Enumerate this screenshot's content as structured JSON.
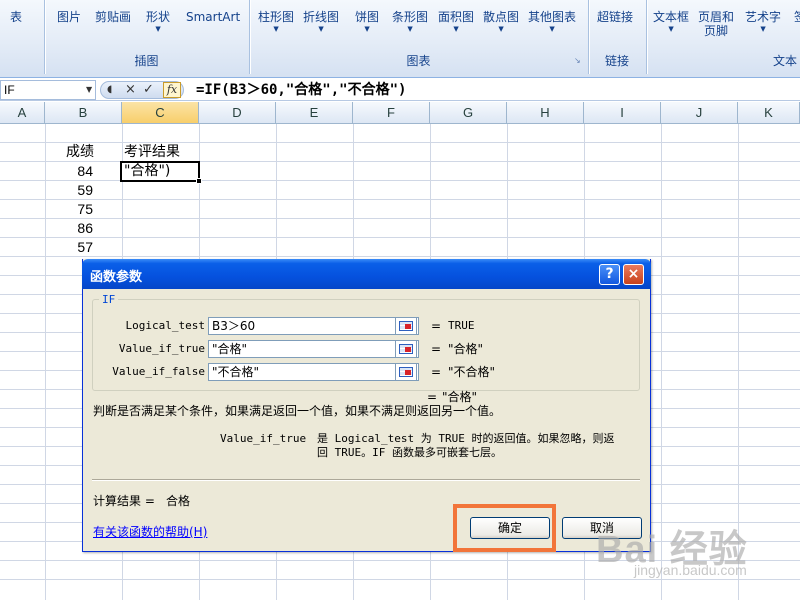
{
  "ribbon": {
    "groups": {
      "illustrations": "插图",
      "charts": "图表",
      "links": "链接",
      "text": "文本"
    },
    "buttons": {
      "table": "表",
      "picture": "图片",
      "clipart": "剪贴画",
      "shapes": "形状",
      "smartart": "SmartArt",
      "column_chart": "柱形图",
      "line_chart": "折线图",
      "pie_chart": "饼图",
      "bar_chart": "条形图",
      "area_chart": "面积图",
      "scatter_chart": "散点图",
      "other_charts": "其他图表",
      "hyperlink": "超链接",
      "textbox": "文本框",
      "header_footer_1": "页眉和",
      "header_footer_2": "页脚",
      "wordart": "艺术字",
      "signature": "签"
    }
  },
  "formula_bar": {
    "name_box": "IF",
    "cancel": "×",
    "enter": "✓",
    "fx": "fx",
    "formula": "=IF(B3＞60,\"合格\",\"不合格\")"
  },
  "columns": [
    "A",
    "B",
    "C",
    "D",
    "E",
    "F",
    "G",
    "H",
    "I",
    "J",
    "K"
  ],
  "sheet": {
    "b_header": "成绩",
    "c_header": "考评结果",
    "scores": [
      "84",
      "59",
      "75",
      "86",
      "57"
    ],
    "active_cell_text": "\"合格\")"
  },
  "dialog": {
    "title": "函数参数",
    "help_button": "?",
    "close_button": "×",
    "function_name": "IF",
    "args": [
      {
        "label": "Logical_test",
        "value": "B3＞60",
        "eq": "=",
        "result": "TRUE"
      },
      {
        "label": "Value_if_true",
        "value": "\"合格\"",
        "eq": "=",
        "result": "\"合格\""
      },
      {
        "label": "Value_if_false",
        "value": "\"不合格\"",
        "eq": "=",
        "result": "\"不合格\""
      }
    ],
    "overall_eq": "=",
    "overall_result": "\"合格\"",
    "description": "判断是否满足某个条件，如果满足返回一个值，如果不满足则返回另一个值。",
    "arg_help_name": "Value_if_true",
    "arg_help_line1": "是 Logical_test 为 TRUE 时的返回值。如果忽略，则返",
    "arg_help_line2": "回 TRUE。IF 函数最多可嵌套七层。",
    "calc_label": "计算结果 =",
    "calc_value": "合格",
    "help_link": "有关该函数的帮助(H)",
    "ok_button": "确定",
    "cancel_button": "取消"
  },
  "watermark": {
    "big": "Bai 经验",
    "small": "jingyan.baidu.com"
  },
  "colors": {
    "highlight": "#f2753a",
    "dialog_title": "#0551de",
    "link": "#0000ff"
  }
}
